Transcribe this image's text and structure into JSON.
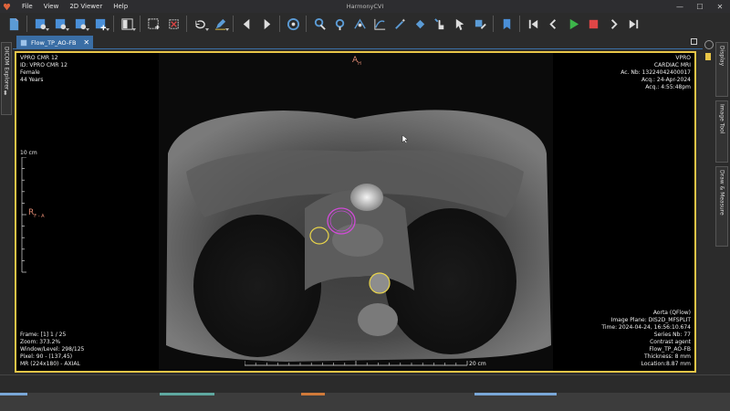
{
  "app": {
    "title": "HarmonyCVI"
  },
  "menu": {
    "items": [
      "File",
      "View",
      "2D Viewer",
      "Help"
    ]
  },
  "window_controls": {
    "minimize": "—",
    "maximize": "☐",
    "close": "✕"
  },
  "toolbar": {
    "icons": [
      "document-icon",
      "layout-1-icon",
      "layout-2-icon",
      "layout-3-icon",
      "layout-add-icon",
      "grid-layout-icon",
      "select-region-icon",
      "crop-icon",
      "rotate-icon",
      "pen-icon",
      "prev-icon",
      "next-icon",
      "target-icon",
      "zoom-icon",
      "cine-icon",
      "contour-icon",
      "curve-icon",
      "wand-icon",
      "paint-bucket-icon",
      "hand-pointer-icon",
      "cursor-measure-icon",
      "link-icon",
      "bookmark-icon",
      "skip-first-icon",
      "step-back-icon",
      "play-icon",
      "stop-icon",
      "step-forward-icon",
      "skip-last-icon"
    ]
  },
  "tab": {
    "label": "Flow_TP_AO-FB",
    "close": "✕"
  },
  "left_dock": {
    "label": "DICOM Explorer"
  },
  "right_dock": {
    "labels": [
      "Display",
      "Image Tool",
      "Draw & Measure"
    ]
  },
  "overlay": {
    "top_left": [
      "VPRO CMR 12",
      "ID: VPRO CMR 12",
      "Female",
      "44 Years"
    ],
    "top_right": [
      "VPRO",
      "CARDIAC MRI",
      "Ac. Nb: 13224042400017",
      "Acq.: 24-Apr-2024",
      "Acq.: 4:55:48pm"
    ],
    "bottom_left": [
      "Frame: [1] 1 / 25",
      "Zoom: 373.2%",
      "Window/Level: 298/125",
      "Pixel: 90 - (137,45)",
      "MR (224x180) - AXIAL"
    ],
    "bottom_right": [
      "Aorta (QFlow)",
      "Image Plane: DIS2D_MFSPLIT",
      "Time: 2024-04-24, 16:56:10.674",
      "Series Nb: 77",
      "Contrast agent",
      "Flow_TP_AO-FB",
      "Thickness: 8 mm",
      "Location:8.87 mm"
    ],
    "orientation_top": "A",
    "orientation_top_sub": "H",
    "orientation_left": "R",
    "orientation_left_sub": "F - A",
    "scale_left_label": "10 cm",
    "scale_bottom_label": "20 cm"
  },
  "colors": {
    "accent": "#3a6ea5",
    "viewer_border": "#e8c547",
    "roi_magenta": "#d14bd8",
    "roi_yellow": "#e8d44a",
    "orientation": "#e28b73"
  }
}
